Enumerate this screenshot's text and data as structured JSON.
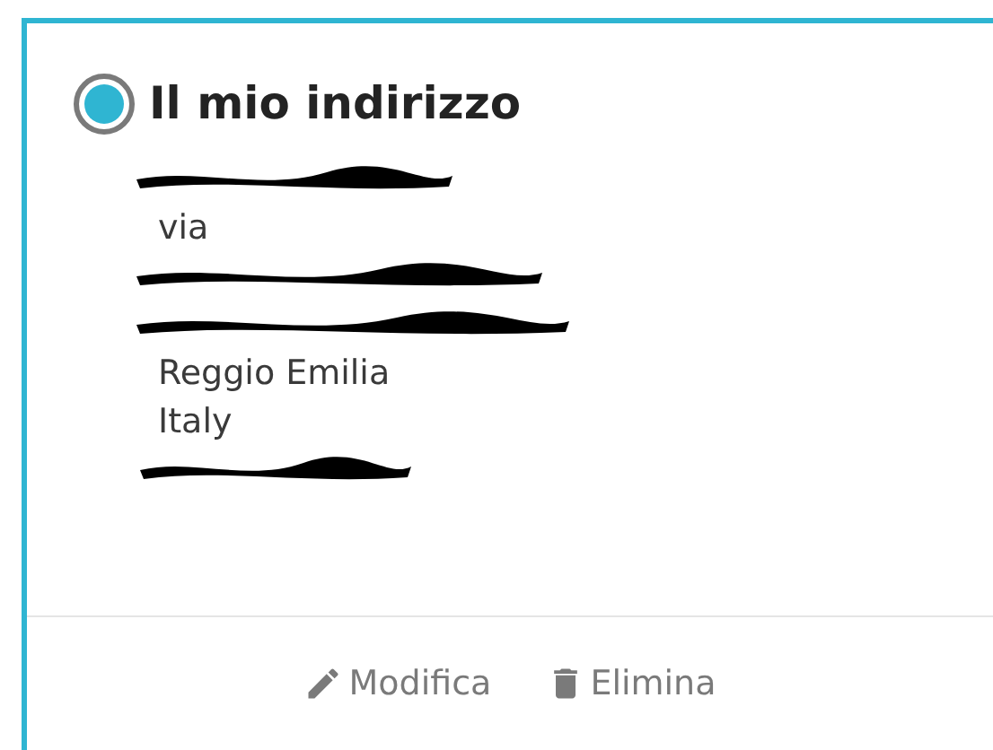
{
  "address_card": {
    "title": "Il mio indirizzo",
    "selected": true,
    "lines": [
      {
        "kind": "redacted"
      },
      {
        "kind": "text",
        "text": "via"
      },
      {
        "kind": "redacted"
      },
      {
        "kind": "redacted"
      },
      {
        "kind": "text",
        "text": "Reggio Emilia"
      },
      {
        "kind": "text",
        "text": "Italy"
      },
      {
        "kind": "redacted"
      }
    ],
    "actions": [
      {
        "kind": "edit",
        "label": "Modifica"
      },
      {
        "kind": "delete",
        "label": "Elimina"
      }
    ]
  }
}
